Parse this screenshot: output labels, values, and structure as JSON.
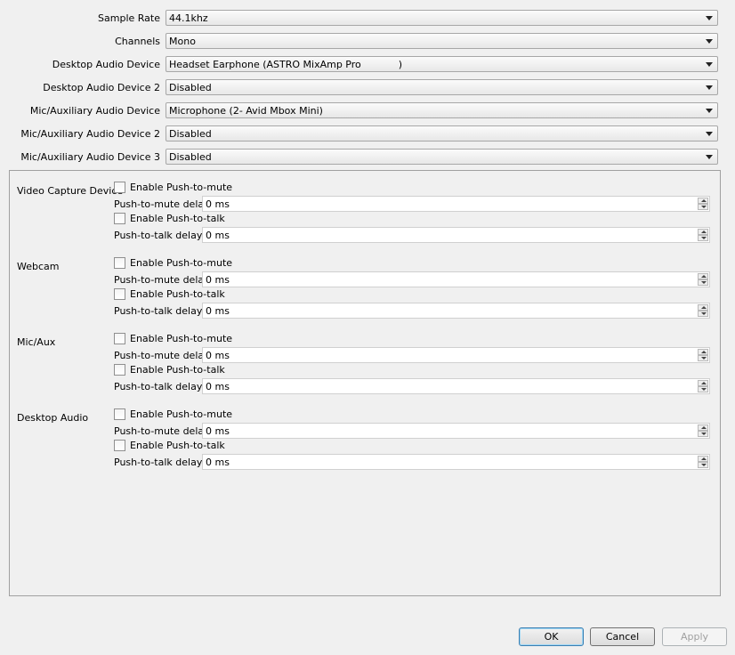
{
  "audio_settings": [
    {
      "label": "Sample Rate",
      "value": "44.1khz"
    },
    {
      "label": "Channels",
      "value": "Mono"
    },
    {
      "label": "Desktop Audio Device",
      "value": "Headset Earphone (ASTRO MixAmp Pro            )"
    },
    {
      "label": "Desktop Audio Device 2",
      "value": "Disabled"
    },
    {
      "label": "Mic/Auxiliary Audio Device",
      "value": "Microphone (2- Avid Mbox Mini)"
    },
    {
      "label": "Mic/Auxiliary Audio Device 2",
      "value": "Disabled"
    },
    {
      "label": "Mic/Auxiliary Audio Device 3",
      "value": "Disabled"
    }
  ],
  "hotkey_sources": [
    {
      "name": "Video Capture Device",
      "push_to_mute_label": "Enable Push-to-mute",
      "push_to_mute_delay_label": "Push-to-mute delay",
      "push_to_mute_delay": "0 ms",
      "push_to_talk_label": "Enable Push-to-talk",
      "push_to_talk_delay_label": "Push-to-talk delay",
      "push_to_talk_delay": "0 ms"
    },
    {
      "name": "Webcam",
      "push_to_mute_label": "Enable Push-to-mute",
      "push_to_mute_delay_label": "Push-to-mute delay",
      "push_to_mute_delay": "0 ms",
      "push_to_talk_label": "Enable Push-to-talk",
      "push_to_talk_delay_label": "Push-to-talk delay",
      "push_to_talk_delay": "0 ms"
    },
    {
      "name": "Mic/Aux",
      "push_to_mute_label": "Enable Push-to-mute",
      "push_to_mute_delay_label": "Push-to-mute delay",
      "push_to_mute_delay": "0 ms",
      "push_to_talk_label": "Enable Push-to-talk",
      "push_to_talk_delay_label": "Push-to-talk delay",
      "push_to_talk_delay": "0 ms"
    },
    {
      "name": "Desktop Audio",
      "push_to_mute_label": "Enable Push-to-mute",
      "push_to_mute_delay_label": "Push-to-mute delay",
      "push_to_mute_delay": "0 ms",
      "push_to_talk_label": "Enable Push-to-talk",
      "push_to_talk_delay_label": "Push-to-talk delay",
      "push_to_talk_delay": "0 ms"
    }
  ],
  "buttons": {
    "ok": "OK",
    "cancel": "Cancel",
    "apply": "Apply"
  }
}
